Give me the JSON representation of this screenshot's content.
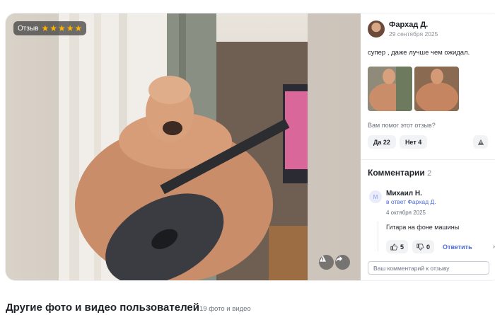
{
  "photo": {
    "badge_label": "Отзыв",
    "rating_stars": 5,
    "report_icon": "warning-icon",
    "share_icon": "share-arrow-icon"
  },
  "review": {
    "author_name": "Фархад Д.",
    "date": "29 сентября 2025",
    "text": "супер , даже лучше чем ожидал.",
    "helpful_question": "Вам помог этот отзыв?",
    "yes_label": "Да 22",
    "no_label": "Нет 4"
  },
  "comments": {
    "heading": "Комментарии",
    "count": "2",
    "items": [
      {
        "avatar_letter": "М",
        "name": "Михаил Н.",
        "reply_to": "в ответ Фархад Д.",
        "date": "4 октября 2025",
        "text": "Гитара на фоне машины",
        "likes": "5",
        "dislikes": "0",
        "reply_label": "Ответить"
      }
    ],
    "input_placeholder": "Ваш комментарий к отзыву"
  },
  "section": {
    "title": "Другие фото и видео пользователей",
    "subtitle": "19 фото и видео"
  },
  "colors": {
    "accent": "#4b6bdc",
    "star": "#ffb400"
  }
}
